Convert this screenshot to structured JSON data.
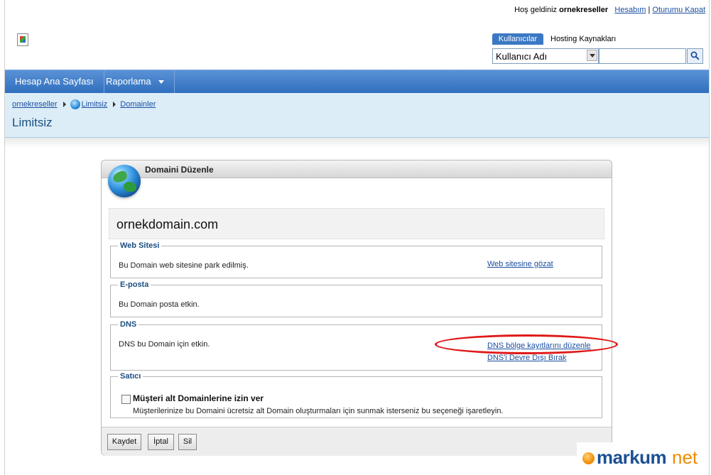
{
  "header": {
    "welcome_prefix": "Hoş geldiniz",
    "username": "ornekreseller",
    "account_link": "Hesabım",
    "separator": "|",
    "logout_link": "Oturumu Kapat"
  },
  "search": {
    "tab_active": "Kullanıcılar",
    "tab_other": "Hosting Kaynakları",
    "field_select": "Kullanıcı Adı",
    "query": ""
  },
  "nav": {
    "home": "Hesap Ana Sayfası",
    "reports": "Raporlama"
  },
  "breadcrumb": {
    "item1": "ornekreseller",
    "item2": "Limitsiz",
    "item3": "Domainler"
  },
  "page_title": "Limitsiz",
  "panel": {
    "title": "Domaini Düzenle",
    "domain": "ornekdomain.com",
    "website": {
      "legend": "Web Sitesi",
      "text": "Bu Domain web sitesine park edilmiş.",
      "link": "Web sitesine gözat"
    },
    "email": {
      "legend": "E-posta",
      "text": "Bu Domain posta etkin."
    },
    "dns": {
      "legend": "DNS",
      "text": "DNS bu Domain için etkin.",
      "link_edit": "DNS bölge kayıtlarını düzenle",
      "link_disable": "DNS'i Devre Dışı Bırak"
    },
    "reseller": {
      "legend": "Satıcı",
      "checkbox_label": "Müşteri alt Domainlerine izin ver",
      "checkbox_checked": false,
      "description": "Müşterilerinize bu Domaini ücretsiz alt Domain oluşturmaları için sunmak isterseniz bu seçeneği işaretleyin."
    },
    "buttons": {
      "save": "Kaydet",
      "cancel": "İptal",
      "delete": "Sil"
    }
  },
  "watermark": {
    "part1": "markum",
    "part2": "net"
  },
  "colors": {
    "nav_blue": "#2f6fbe",
    "crumb_bg": "#dcedf8",
    "title_blue": "#1d4e80",
    "annotation_red": "#e01818"
  }
}
